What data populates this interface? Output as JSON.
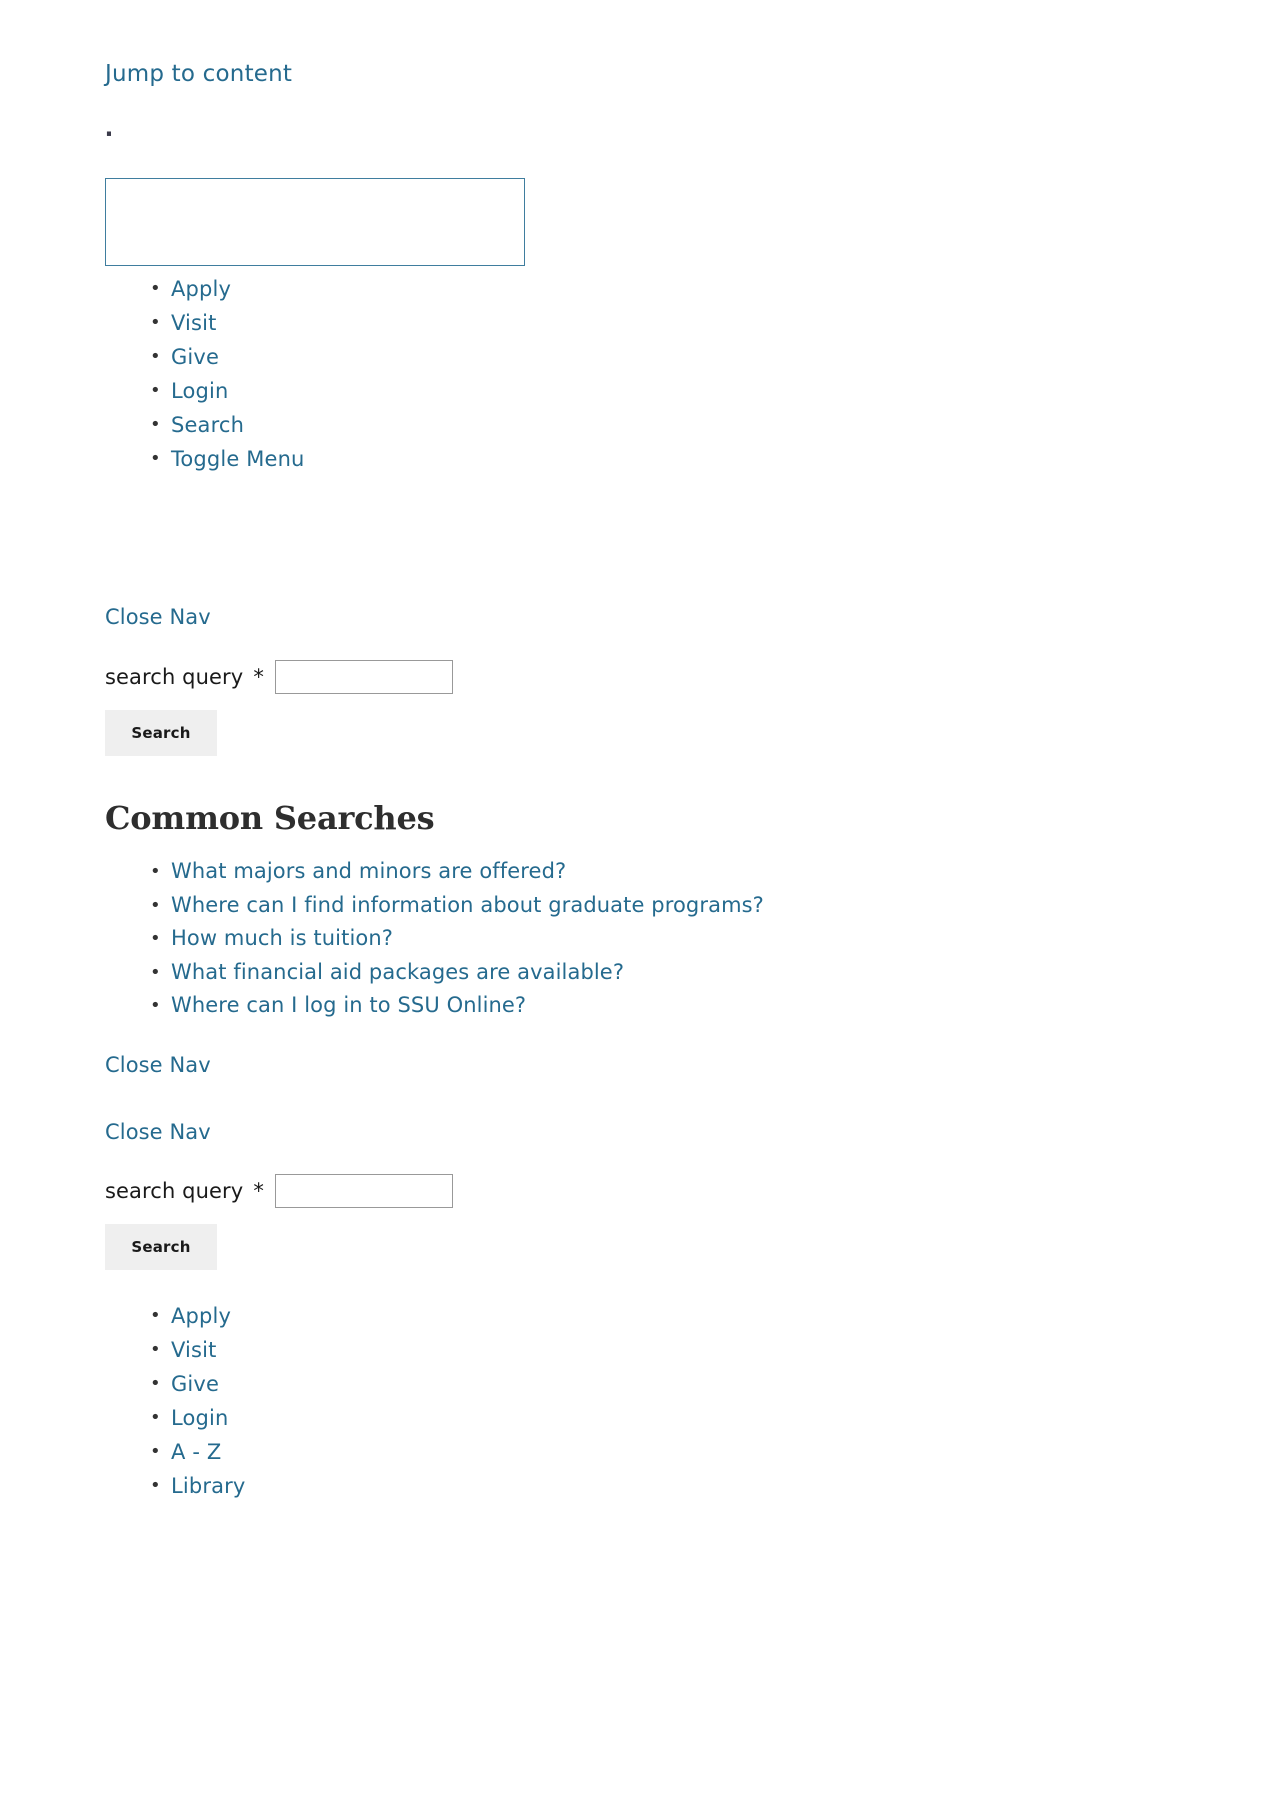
{
  "colors": {
    "link": "#256a8e",
    "text": "#222222",
    "logo_box_border": "#3f7d9e",
    "input_border": "#999999",
    "button_bg": "#efefef"
  },
  "skip_link": {
    "label": "Jump to content"
  },
  "logo": {
    "alt_marker": "",
    "placeholder_box": ""
  },
  "top_nav": {
    "items": [
      {
        "label": "Apply"
      },
      {
        "label": "Visit"
      },
      {
        "label": "Give"
      },
      {
        "label": "Login"
      },
      {
        "label": "Search"
      },
      {
        "label": "Toggle Menu"
      }
    ]
  },
  "close_nav": {
    "label_1": "Close Nav",
    "label_2": "Close Nav",
    "label_3": "Close Nav"
  },
  "search_form_1": {
    "label": "search query",
    "required_marker": "*",
    "value": "",
    "placeholder": "",
    "submit_label": "Search"
  },
  "search_form_2": {
    "label": "search query",
    "required_marker": "*",
    "value": "",
    "placeholder": "",
    "submit_label": "Search"
  },
  "common_searches": {
    "heading": "Common Searches",
    "items": [
      {
        "label": "What majors and minors are offered?"
      },
      {
        "label": "Where can I find information about graduate programs?"
      },
      {
        "label": "How much is tuition?"
      },
      {
        "label": "What financial aid packages are available?"
      },
      {
        "label": "Where can I log in to SSU Online?"
      }
    ]
  },
  "bottom_nav": {
    "items": [
      {
        "label": "Apply"
      },
      {
        "label": "Visit"
      },
      {
        "label": "Give"
      },
      {
        "label": "Login"
      },
      {
        "label": "A - Z"
      },
      {
        "label": "Library"
      }
    ]
  }
}
